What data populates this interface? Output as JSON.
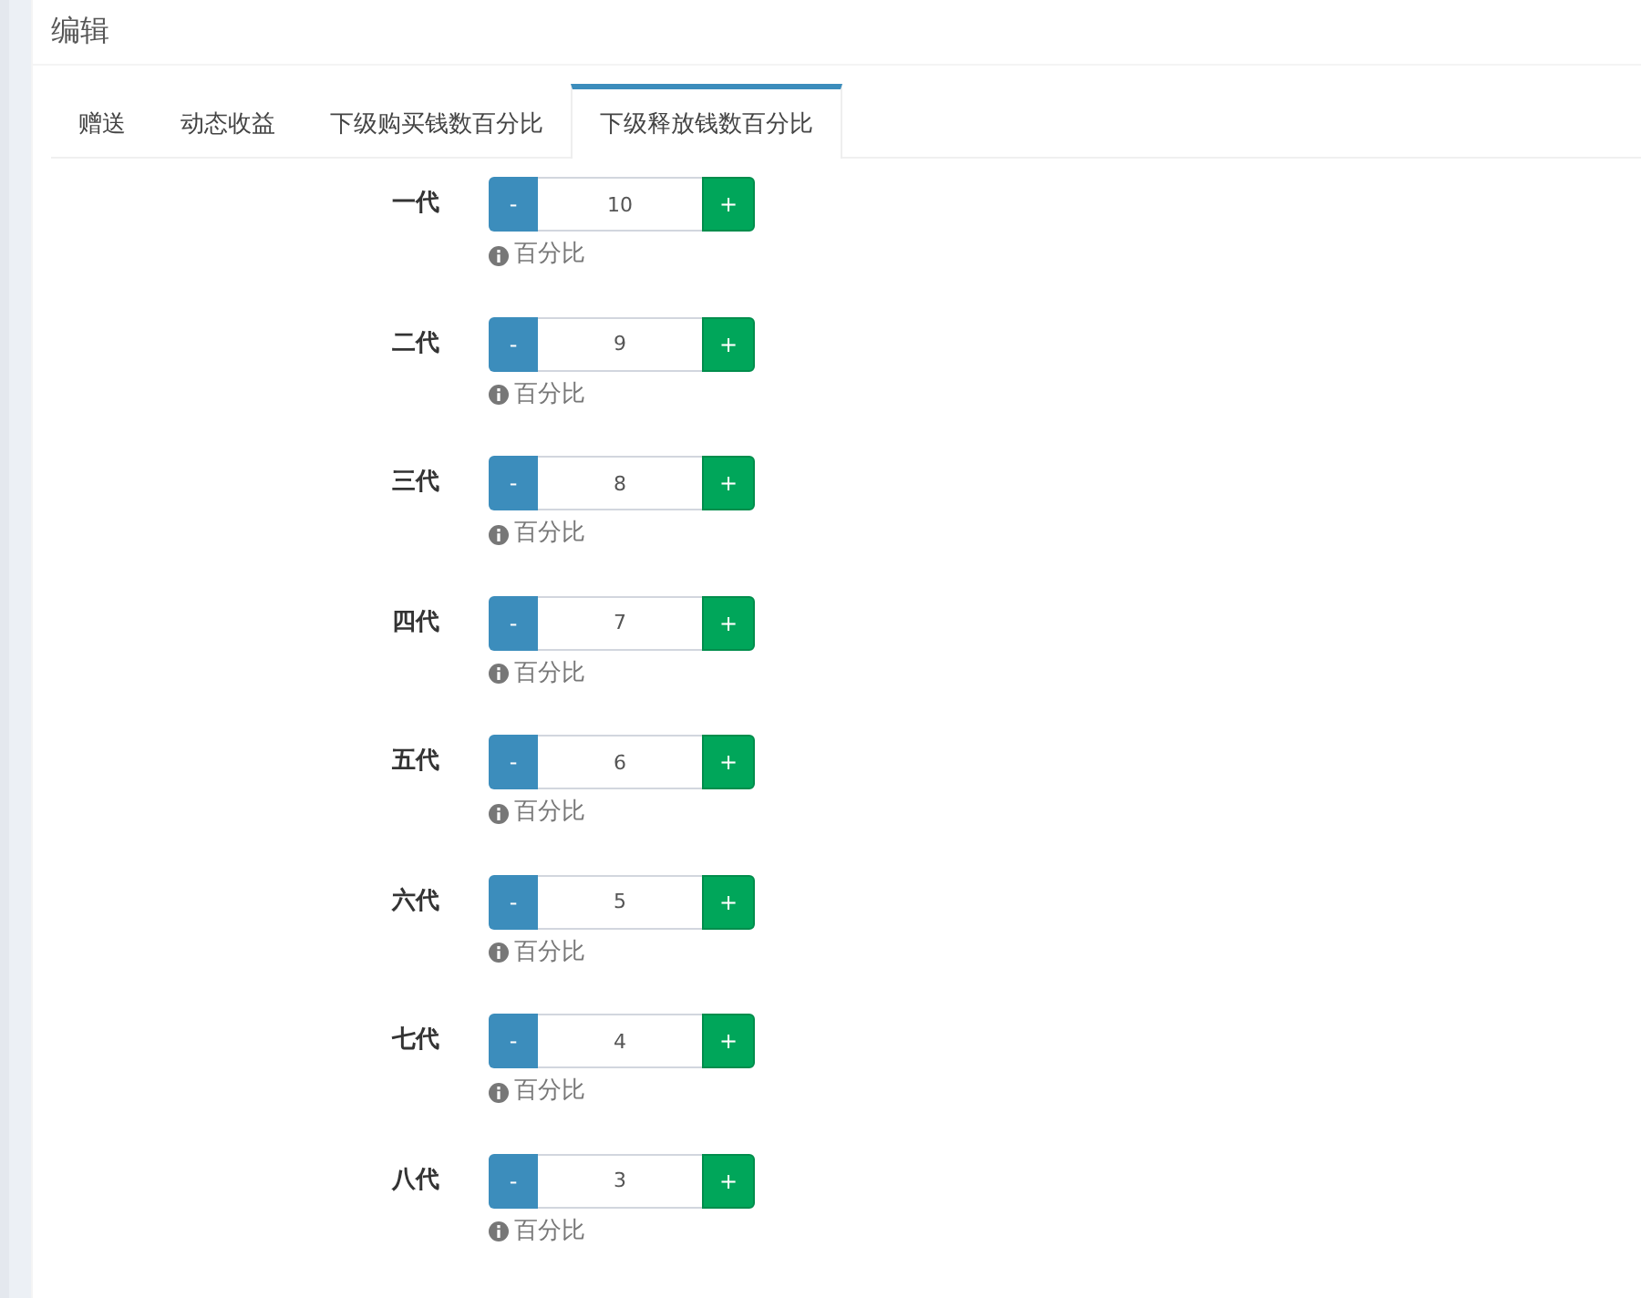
{
  "header": {
    "title": "编辑"
  },
  "tabs": [
    {
      "label": "赠送",
      "selected": false
    },
    {
      "label": "动态收益",
      "selected": false
    },
    {
      "label": "下级购买钱数百分比",
      "selected": false
    },
    {
      "label": "下级释放钱数百分比",
      "selected": true
    }
  ],
  "fields": [
    {
      "label": "一代",
      "value": "10",
      "minus": "-",
      "plus": "+",
      "help": "百分比"
    },
    {
      "label": "二代",
      "value": "9",
      "minus": "-",
      "plus": "+",
      "help": "百分比"
    },
    {
      "label": "三代",
      "value": "8",
      "minus": "-",
      "plus": "+",
      "help": "百分比"
    },
    {
      "label": "四代",
      "value": "7",
      "minus": "-",
      "plus": "+",
      "help": "百分比"
    },
    {
      "label": "五代",
      "value": "6",
      "minus": "-",
      "plus": "+",
      "help": "百分比"
    },
    {
      "label": "六代",
      "value": "5",
      "minus": "-",
      "plus": "+",
      "help": "百分比"
    },
    {
      "label": "七代",
      "value": "4",
      "minus": "-",
      "plus": "+",
      "help": "百分比"
    },
    {
      "label": "八代",
      "value": "3",
      "minus": "-",
      "plus": "+",
      "help": "百分比"
    }
  ]
}
